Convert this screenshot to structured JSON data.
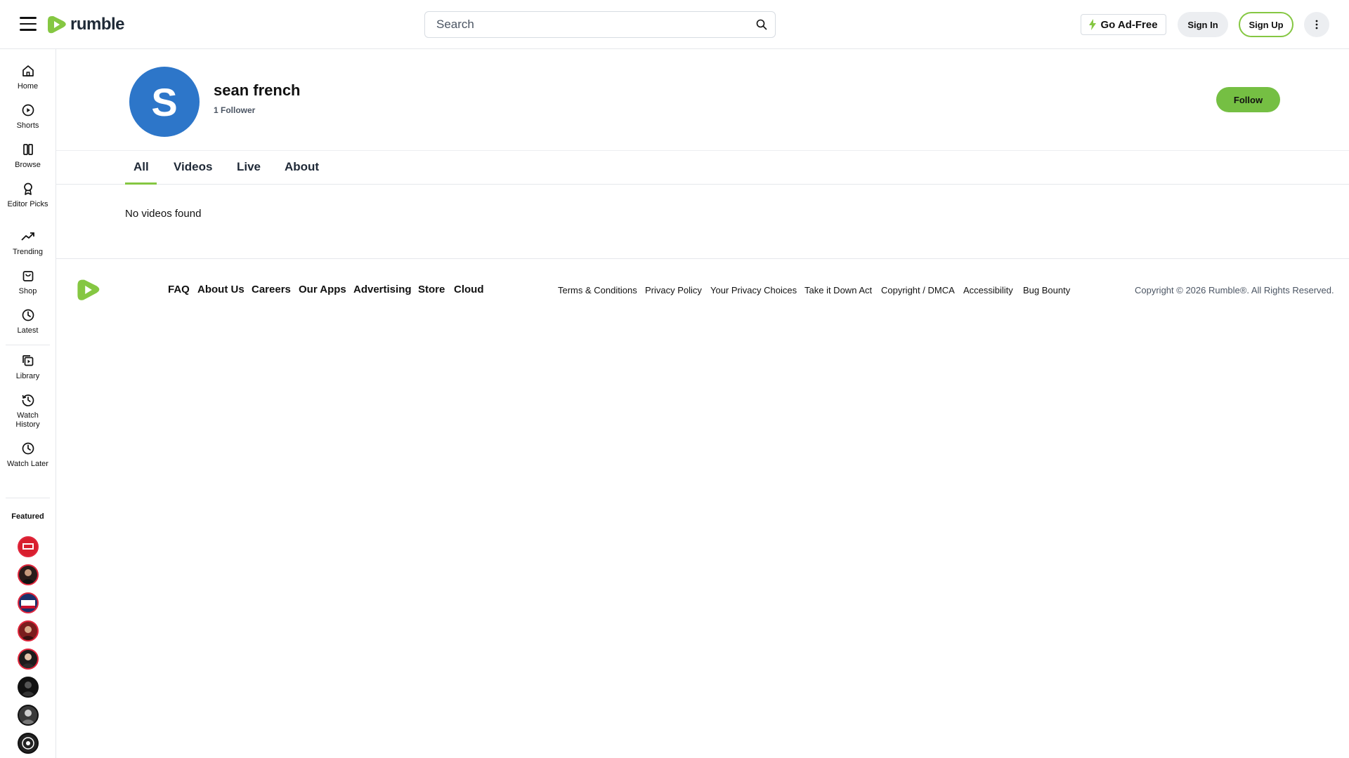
{
  "header": {
    "logo_text": "rumble",
    "search_placeholder": "Search",
    "go_ad_free": "Go Ad-Free",
    "sign_in": "Sign In",
    "sign_up": "Sign Up"
  },
  "sidebar": {
    "items": [
      {
        "label": "Home",
        "icon": "home-icon"
      },
      {
        "label": "Shorts",
        "icon": "shorts-icon"
      },
      {
        "label": "Browse",
        "icon": "browse-icon"
      },
      {
        "label": "Editor Picks",
        "icon": "award-icon"
      },
      {
        "label": "Trending",
        "icon": "trending-icon"
      },
      {
        "label": "Shop",
        "icon": "shop-icon"
      },
      {
        "label": "Latest",
        "icon": "clock-icon"
      },
      {
        "label": "Library",
        "icon": "library-icon"
      },
      {
        "label": "Watch History",
        "icon": "history-icon"
      },
      {
        "label": "Watch Later",
        "icon": "clock-icon"
      }
    ],
    "featured_label": "Featured"
  },
  "profile": {
    "avatar_letter": "S",
    "name": "sean french",
    "followers": "1 Follower",
    "follow_button": "Follow"
  },
  "tabs": [
    {
      "label": "All",
      "active": true
    },
    {
      "label": "Videos",
      "active": false
    },
    {
      "label": "Live",
      "active": false
    },
    {
      "label": "About",
      "active": false
    }
  ],
  "content": {
    "empty_message": "No videos found"
  },
  "footer": {
    "links": [
      "FAQ",
      "About Us",
      "Careers",
      "Our Apps",
      "Advertising",
      "Store",
      "Cloud"
    ],
    "legal": [
      "Terms & Conditions",
      "Privacy Policy",
      "Your Privacy Choices",
      "Take it Down Act",
      "Copyright / DMCA",
      "Accessibility",
      "Bug Bounty"
    ],
    "copyright": "Copyright © 2026 Rumble®. All Rights Reserved."
  },
  "colors": {
    "brand_green": "#85c742",
    "follow_green": "#75bf43",
    "avatar_blue": "#2d76c9",
    "featured_ring": "#e0263c"
  }
}
